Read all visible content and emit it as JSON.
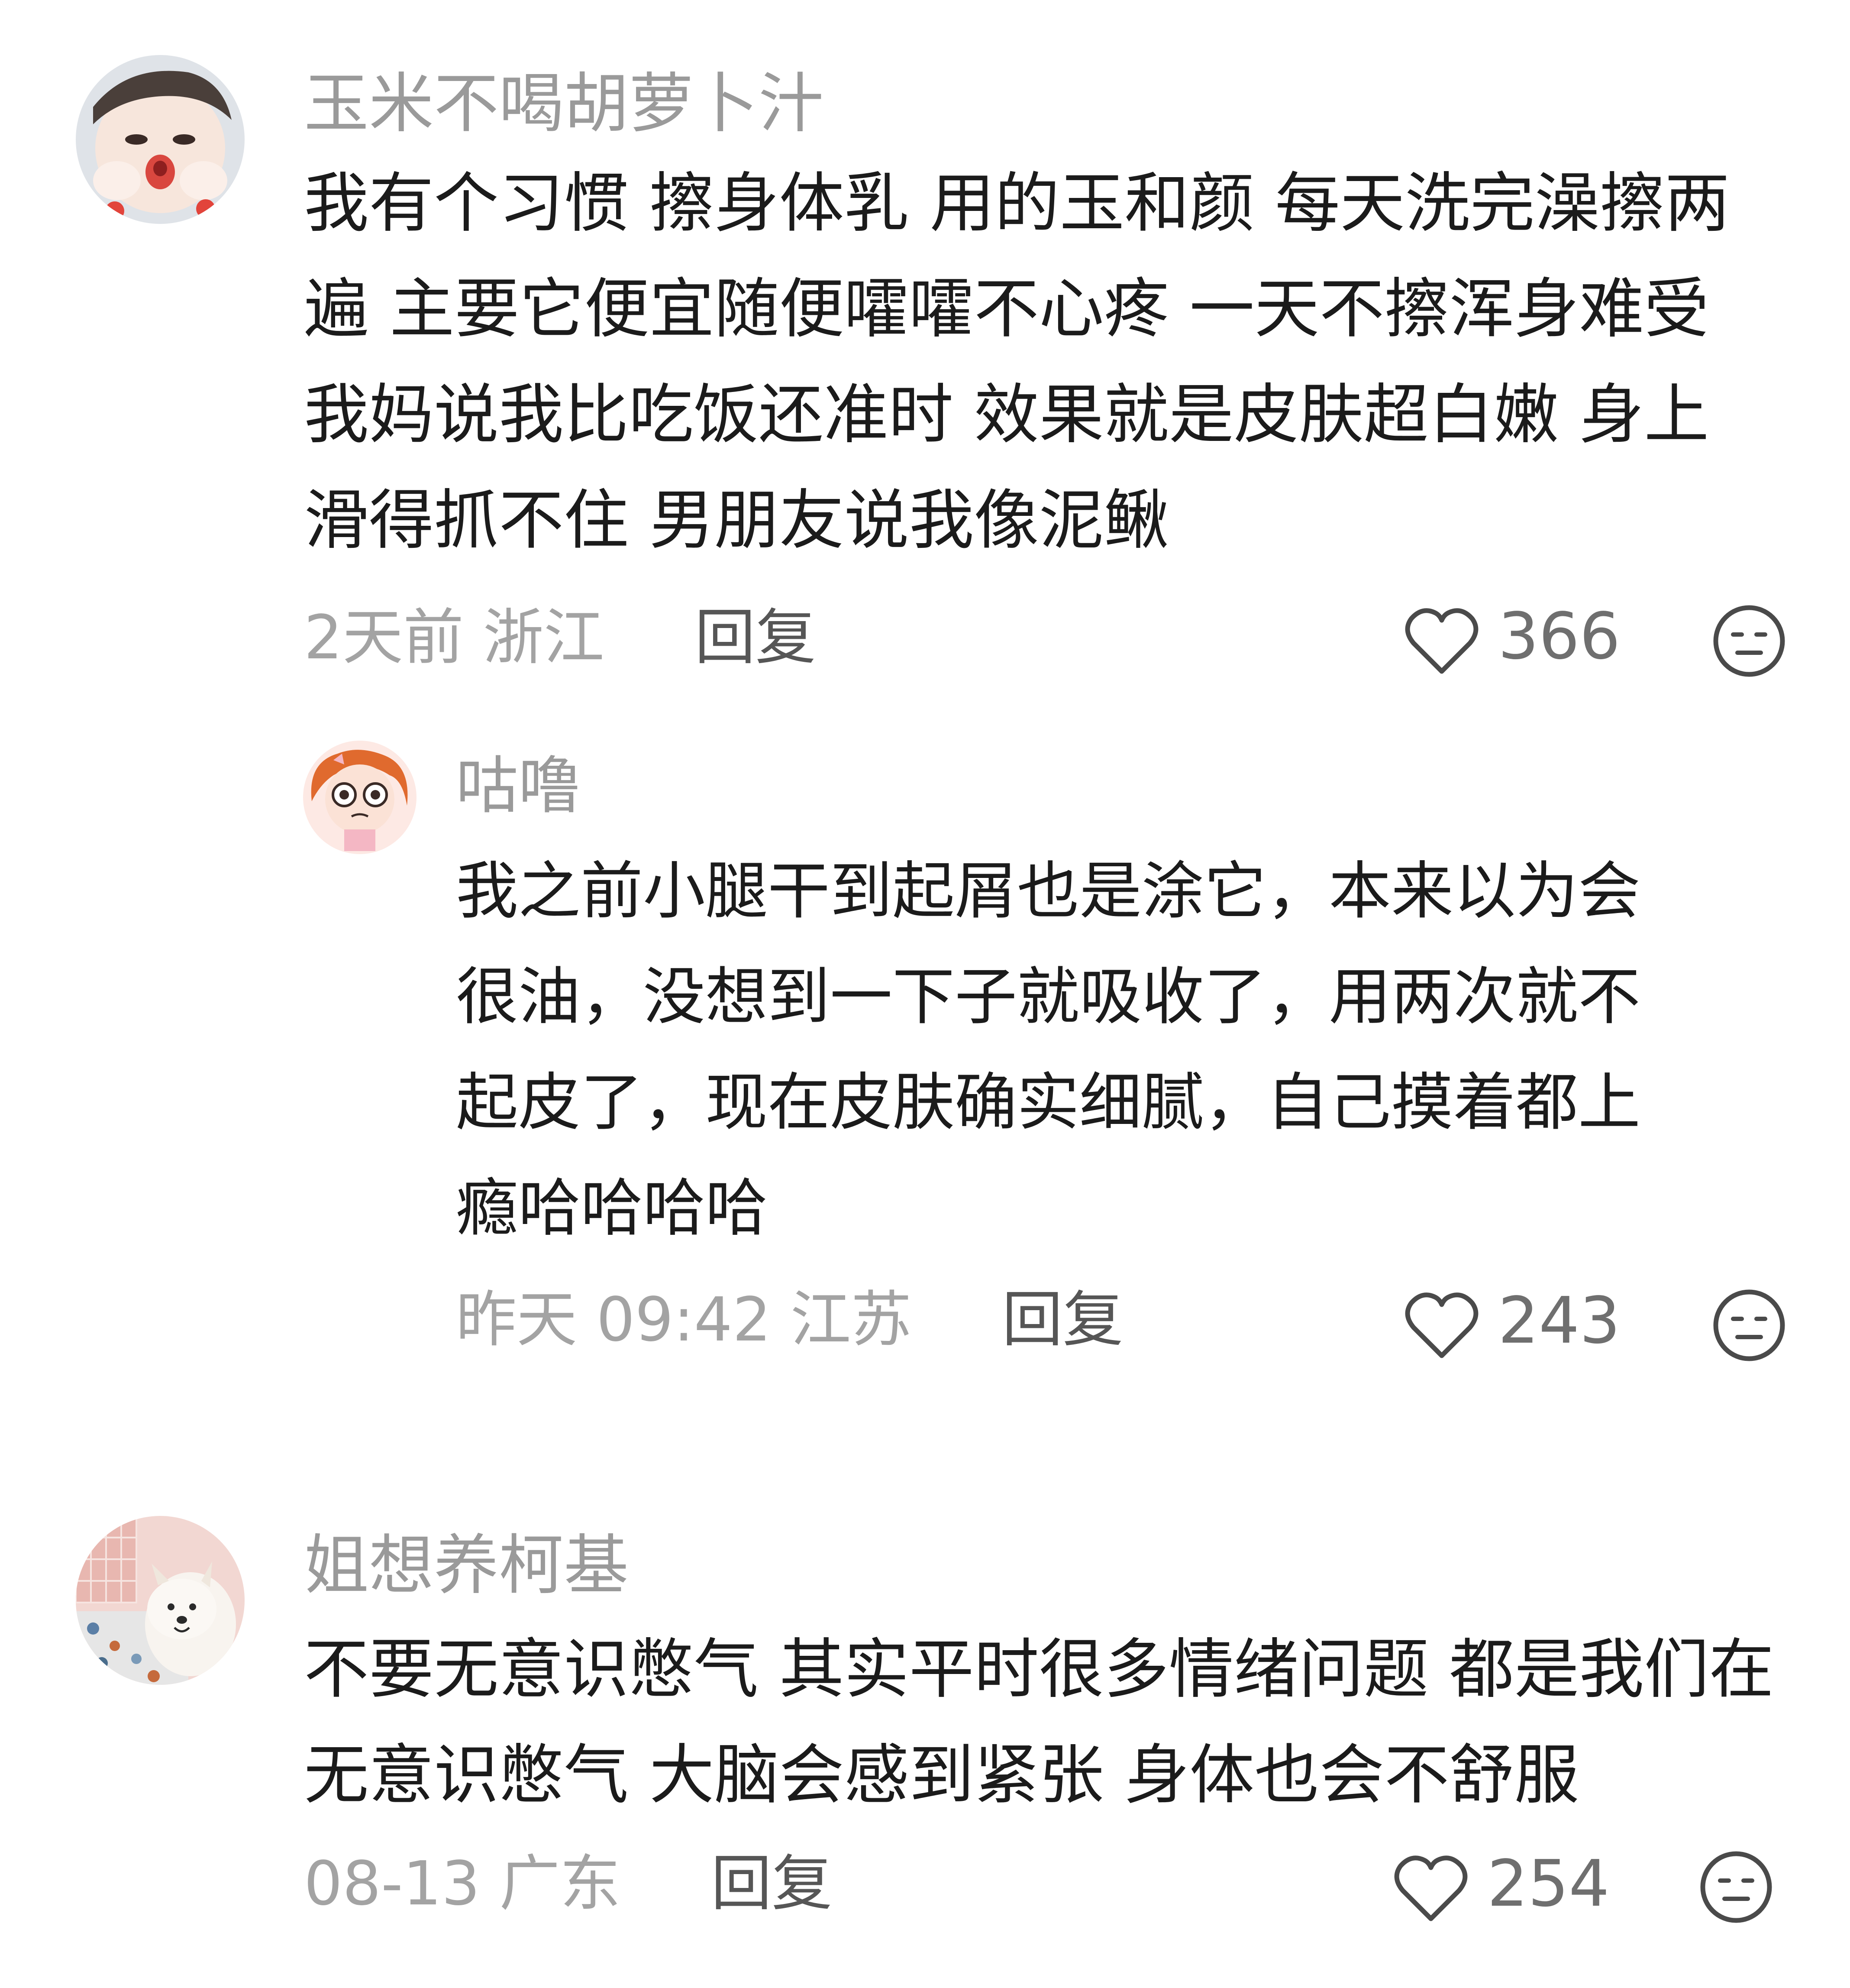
{
  "comments": [
    {
      "username": "玉米不喝胡萝卜汁",
      "lines": [
        "我有个习惯 擦身体乳 用的玉和颜 每天洗完澡擦两",
        "遍 主要它便宜随便嚯嚯不心疼 一天不擦浑身难受",
        "我妈说我比吃饭还准时 效果就是皮肤超白嫩 身上",
        "滑得抓不住 男朋友说我像泥鳅"
      ],
      "time_location": "2天前 浙江",
      "reply_label": "回复",
      "likes": "366",
      "avatar_icon": "baby-face-avatar",
      "replies": [
        {
          "username": "咕噜",
          "lines": [
            "我之前小腿干到起屑也是涂它，本来以为会",
            "很油，没想到一下子就吸收了，用两次就不",
            "起皮了，现在皮肤确实细腻，自己摸着都上",
            "瘾哈哈哈哈"
          ],
          "time_location": "昨天 09:42 江苏",
          "reply_label": "回复",
          "likes": "243",
          "avatar_icon": "cartoon-girl-avatar"
        }
      ]
    },
    {
      "username": "姐想养柯基",
      "lines": [
        "不要无意识憋气 其实平时很多情绪问题 都是我们在",
        "无意识憋气 大脑会感到紧张 身体也会不舒服"
      ],
      "time_location": "08-13 广东",
      "reply_label": "回复",
      "likes": "254",
      "avatar_icon": "white-dog-avatar"
    }
  ],
  "icons": {
    "like": "heart-outline-icon",
    "dislike": "neutral-face-icon"
  },
  "colors": {
    "username": "#9a9a9a",
    "body": "#1b1b1b",
    "meta": "#a3a3a3",
    "reply": "#565656",
    "like_count": "#6f6f6f"
  }
}
